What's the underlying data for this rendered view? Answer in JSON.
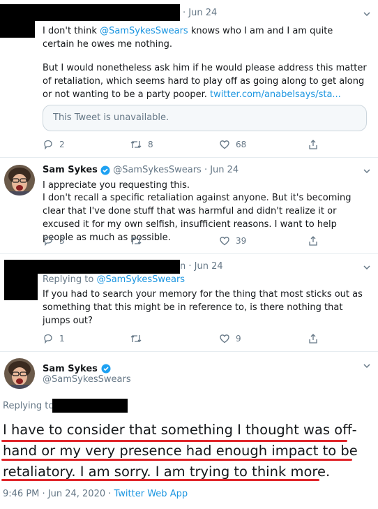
{
  "tweet1": {
    "time": "· Jun 24",
    "text_pre": "I don't think ",
    "mention": "@SamSykesSwears",
    "text_post": " knows who I am and I am quite certain he owes me nothing.",
    "para2": "But I would nonetheless ask him if he would please address this matter of retaliation, which seems hard to play off as going along to get along or not wanting to be a party pooper. ",
    "link": "twitter.com/anabelsays/sta...",
    "quoted": "This Tweet is unavailable.",
    "replies": "2",
    "retweets": "8",
    "likes": "68"
  },
  "tweet2": {
    "name": "Sam Sykes",
    "handle": "@SamSykesSwears · Jun 24",
    "line1": "I appreciate you requesting this.",
    "line2": "I don't recall a specific retaliation against anyone. But it's becoming clear that I've done stuff that was harmful and didn't realize it or excused it for my own selfish, insufficient reasons. I want to help people as much as possible.",
    "replies": "3",
    "likes": "39"
  },
  "tweet3": {
    "time": "n · Jun 24",
    "replying_label": "Replying to ",
    "replying_to": "@SamSykesSwears",
    "text": "If you had to search your memory for the thing that most sticks out as something that this might be in reference to, is there nothing that jumps out?",
    "replies": "1",
    "likes": "9"
  },
  "main": {
    "name": "Sam Sykes",
    "handle": "@SamSykesSwears",
    "replying_label": "Replying to",
    "line1": "I have to consider that something I thought was off-",
    "line2": "hand or  my very presence had enough impact to be",
    "line3": "retaliatory. I am sorry. I am trying to think more.",
    "timestamp": "9:46 PM · Jun 24, 2020 · ",
    "source": "Twitter Web App"
  },
  "colors": {
    "link": "#1b95e0",
    "verified": "#1da1f2",
    "underline": "#e0262b",
    "muted": "#657786"
  }
}
